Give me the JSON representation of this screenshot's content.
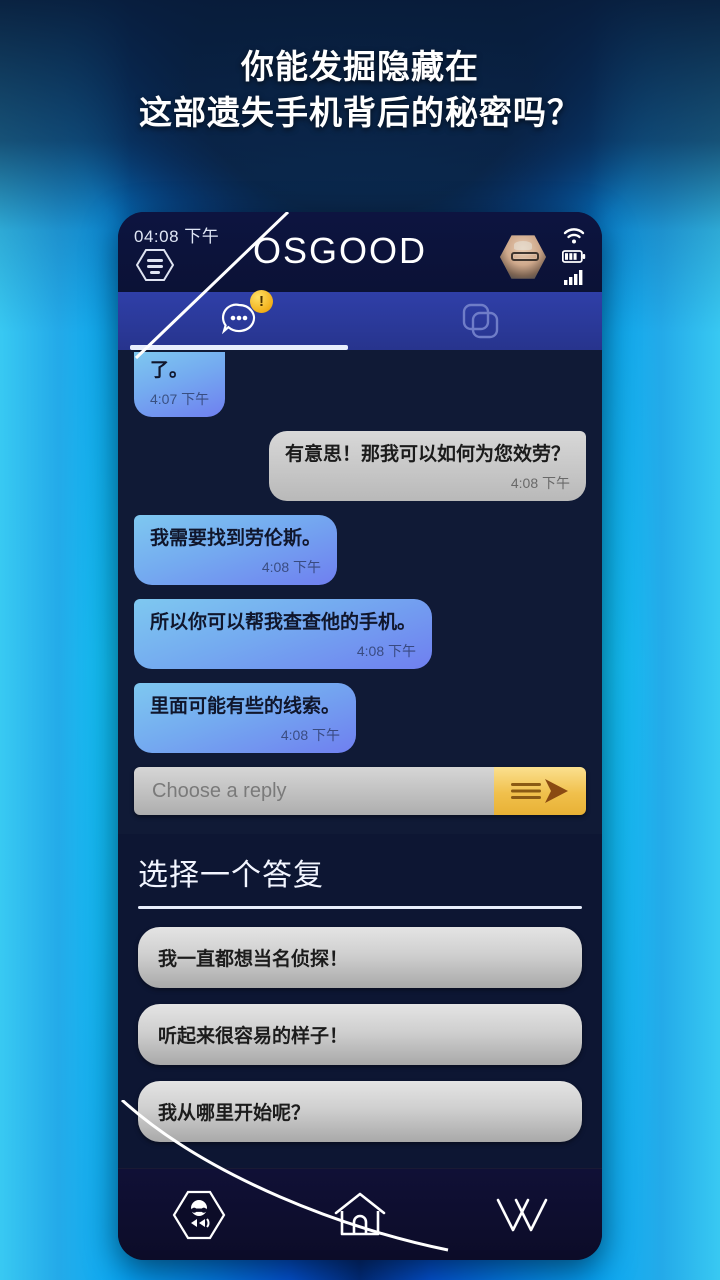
{
  "promo": {
    "headline_line1": "你能发掘隐藏在",
    "headline_line2": "这部遗失手机背后的秘密吗？"
  },
  "colors": {
    "accent_blue": "#1fb6e8",
    "phone_bg": "#101a36",
    "tab_bar": "#2f3fa8",
    "badge_yellow": "#f2b01a",
    "send_button": "#f0c04c",
    "bubble_them": "#74aaf0",
    "bubble_me": "#c6c6c6"
  },
  "status_bar": {
    "time": "04:08 下午",
    "menu_icon": "hamburger-hex-icon",
    "wifi_icon": "wifi-icon",
    "battery_icon": "battery-icon",
    "signal_icon": "signal-bars-icon"
  },
  "header": {
    "title": "OSGOOD",
    "avatar_icon": "contact-avatar"
  },
  "tabs": [
    {
      "name": "messages",
      "icon": "chat-bubble-icon",
      "active": true,
      "badge": "!"
    },
    {
      "name": "gallery",
      "icon": "photo-stack-icon",
      "active": false,
      "badge": ""
    }
  ],
  "chat": {
    "messages": [
      {
        "from": "them",
        "text": "了。",
        "time": "4:07 下午",
        "clipped": true
      },
      {
        "from": "me",
        "text": "有意思！那我可以如何为您效劳？",
        "time": "4:08 下午",
        "clipped": false
      },
      {
        "from": "them",
        "text": "我需要找到劳伦斯。",
        "time": "4:08 下午",
        "clipped": false
      },
      {
        "from": "them",
        "text": "所以你可以帮我查查他的手机。",
        "time": "4:08 下午",
        "clipped": false
      },
      {
        "from": "them",
        "text": "里面可能有些的线索。",
        "time": "4:08 下午",
        "clipped": false
      }
    ]
  },
  "composer": {
    "placeholder": "Choose a reply",
    "value": "",
    "send_icon": "send-arrow-icon"
  },
  "reply_panel": {
    "title": "选择一个答复",
    "options": [
      "我一直都想当名侦探！",
      "听起来很容易的样子！",
      "我从哪里开始呢？"
    ]
  },
  "bottom_nav": [
    {
      "name": "profile",
      "icon": "character-hex-icon"
    },
    {
      "name": "home",
      "icon": "home-icon"
    },
    {
      "name": "collapse",
      "icon": "chevron-down-icon"
    }
  ]
}
